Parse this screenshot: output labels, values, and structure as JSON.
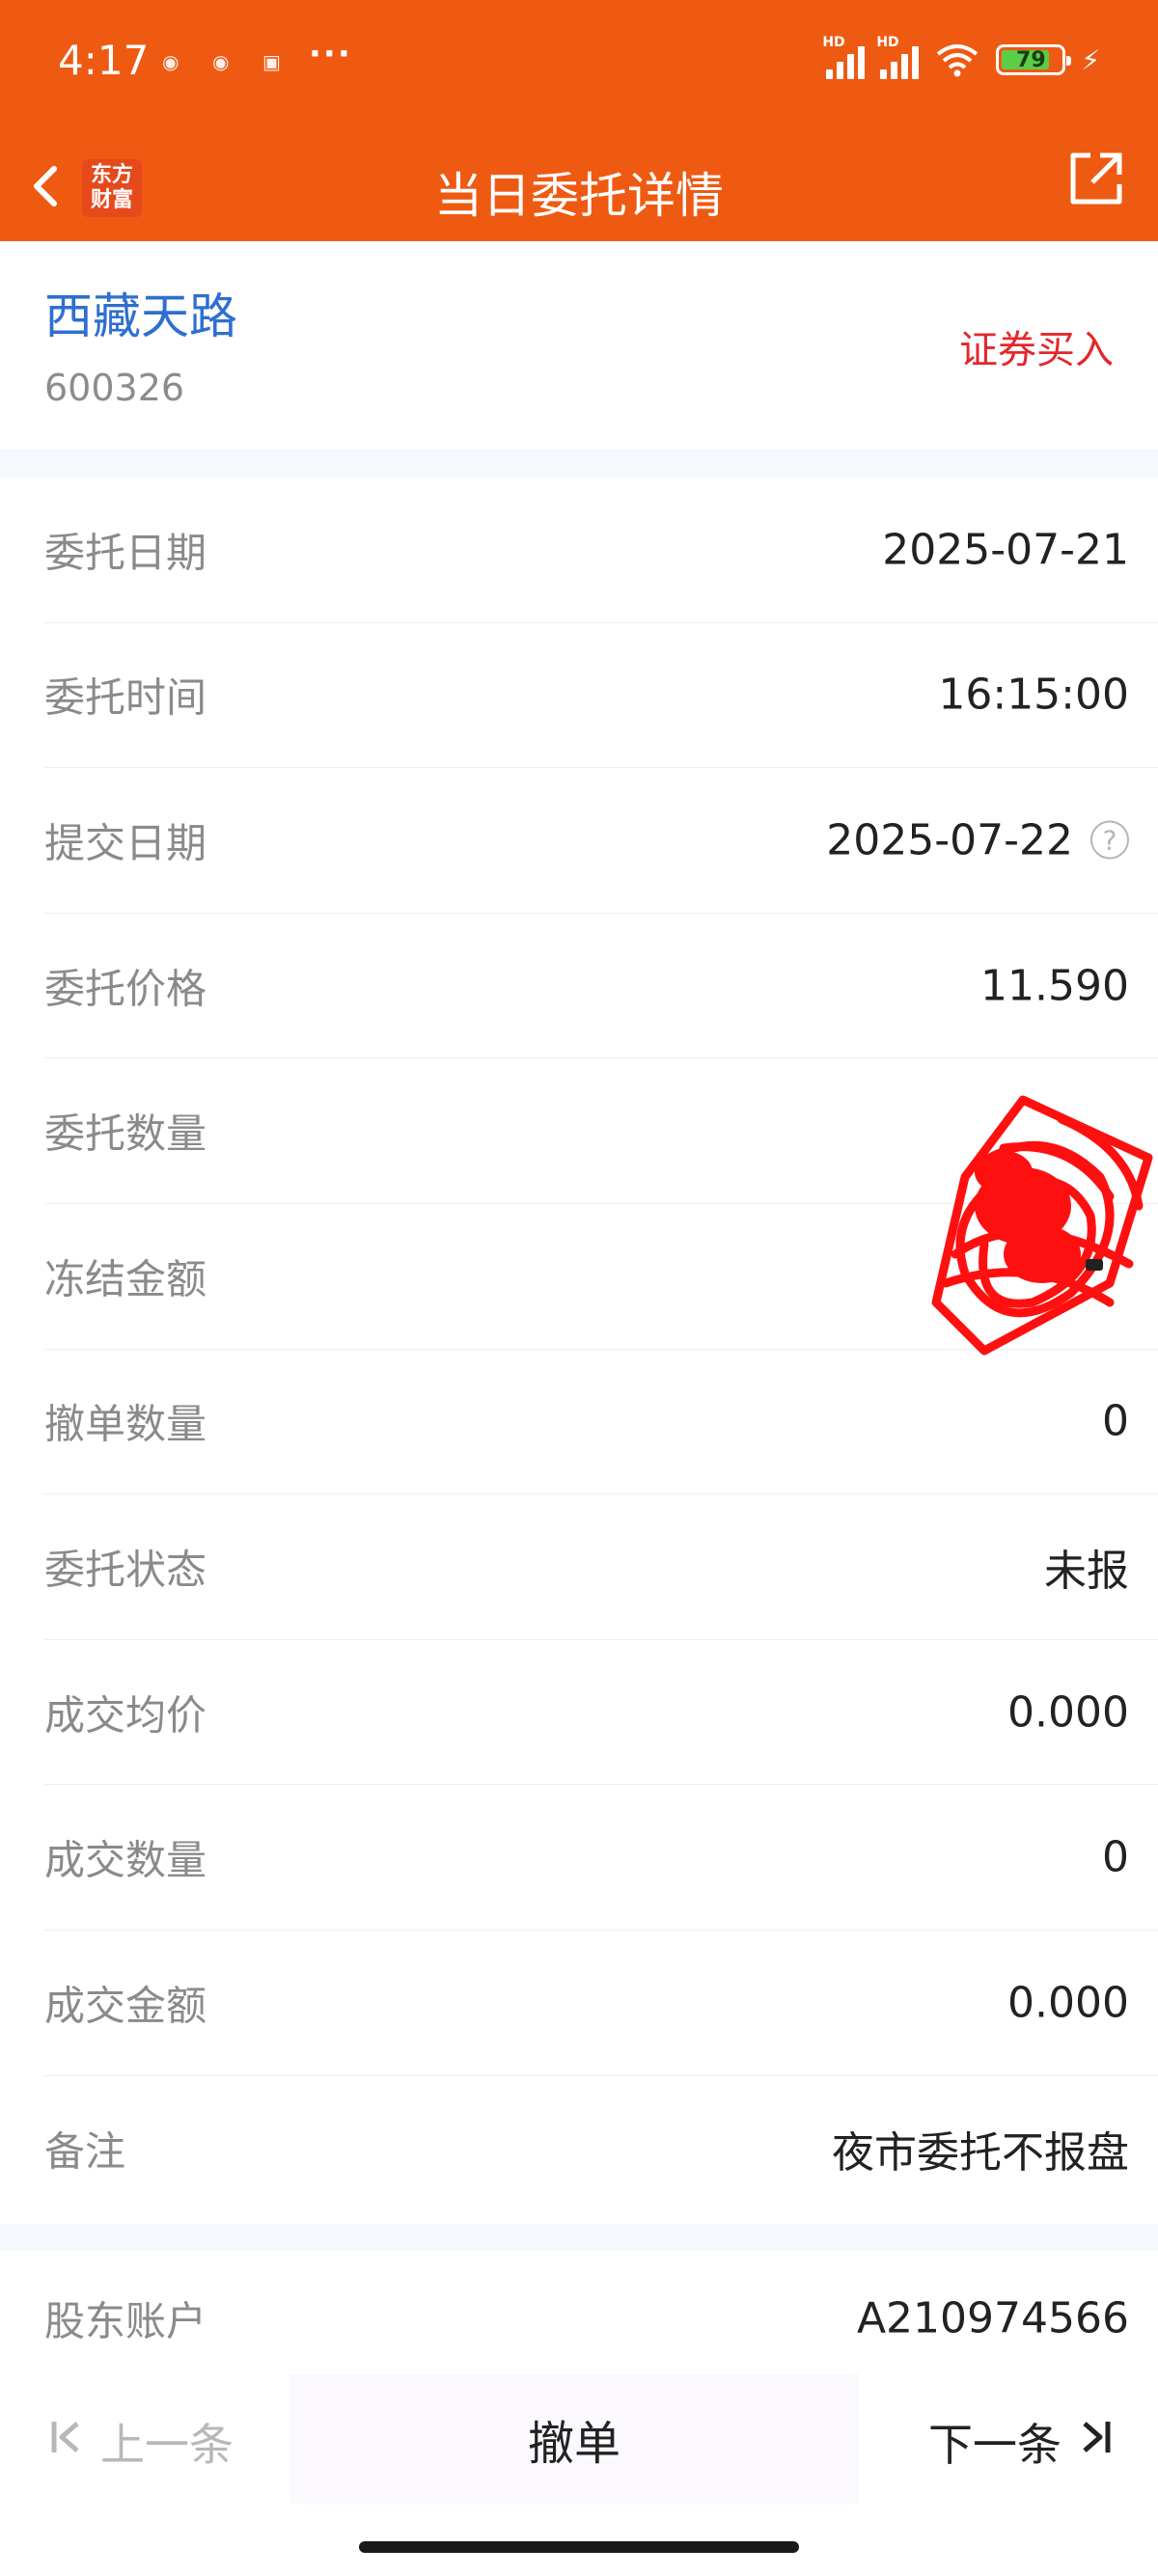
{
  "status_bar": {
    "time": "4:17",
    "battery": "79"
  },
  "header": {
    "title": "当日委托详情",
    "logo_text": "东方财富"
  },
  "stock": {
    "name": "西藏天路",
    "code": "600326",
    "order_type": "证券买入"
  },
  "details": [
    {
      "label": "委托日期",
      "value": "2025-07-21"
    },
    {
      "label": "委托时间",
      "value": "16:15:00"
    },
    {
      "label": "提交日期",
      "value": "2025-07-22"
    },
    {
      "label": "委托价格",
      "value": "11.590"
    },
    {
      "label": "委托数量",
      "value": ""
    },
    {
      "label": "冻结金额",
      "value": ""
    },
    {
      "label": "撤单数量",
      "value": "0"
    },
    {
      "label": "委托状态",
      "value": "未报"
    },
    {
      "label": "成交均价",
      "value": "0.000"
    },
    {
      "label": "成交数量",
      "value": "0"
    },
    {
      "label": "成交金额",
      "value": "0.000"
    },
    {
      "label": "备注",
      "value": "夜市委托不报盘"
    }
  ],
  "account": {
    "label": "股东账户",
    "value": "A210974566"
  },
  "bottom": {
    "prev": "上一条",
    "cancel": "撤单",
    "next": "下一条"
  },
  "colors": {
    "brand": "#ef5a12",
    "stock_name": "#2e6fd0",
    "order_type": "#e3272c"
  }
}
